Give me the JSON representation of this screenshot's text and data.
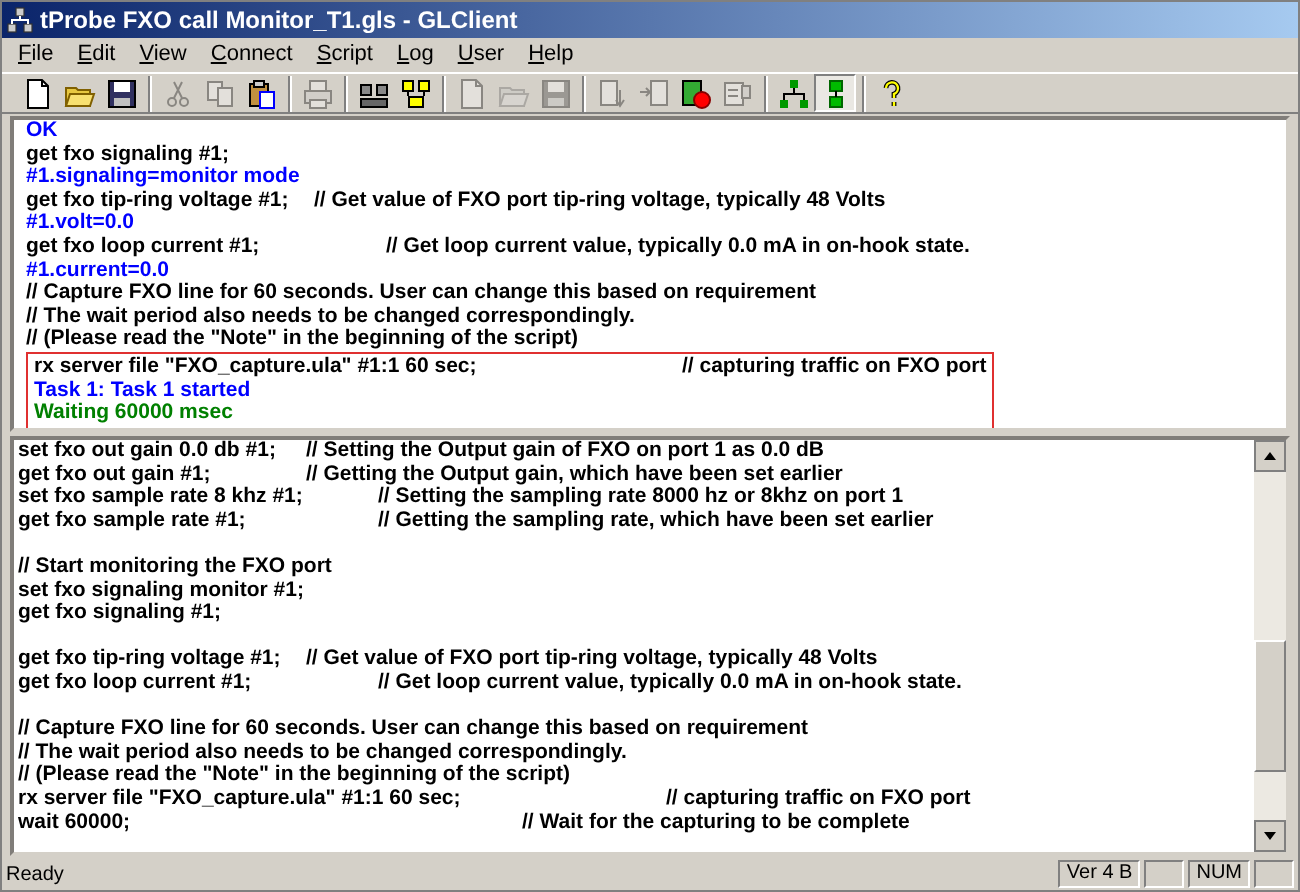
{
  "window": {
    "title": "tProbe FXO call Monitor_T1.gls - GLClient"
  },
  "menu": [
    "File",
    "Edit",
    "View",
    "Connect",
    "Script",
    "Log",
    "User",
    "Help"
  ],
  "toolbar": [
    [
      {
        "kind": "new",
        "disabled": false,
        "pressed": false
      },
      {
        "kind": "open",
        "disabled": false,
        "pressed": false
      },
      {
        "kind": "save",
        "disabled": false,
        "pressed": false
      }
    ],
    [
      {
        "kind": "cut",
        "disabled": true,
        "pressed": false
      },
      {
        "kind": "copy",
        "disabled": true,
        "pressed": false
      },
      {
        "kind": "paste",
        "disabled": false,
        "pressed": false
      }
    ],
    [
      {
        "kind": "print",
        "disabled": true,
        "pressed": false
      }
    ],
    [
      {
        "kind": "connect",
        "disabled": false,
        "pressed": false
      },
      {
        "kind": "disconnect",
        "disabled": false,
        "pressed": false
      }
    ],
    [
      {
        "kind": "new",
        "disabled": true,
        "pressed": false
      },
      {
        "kind": "open",
        "disabled": true,
        "pressed": false
      },
      {
        "kind": "save",
        "disabled": true,
        "pressed": false
      }
    ],
    [
      {
        "kind": "import",
        "disabled": true,
        "pressed": false
      },
      {
        "kind": "export",
        "disabled": true,
        "pressed": false
      },
      {
        "kind": "record",
        "disabled": false,
        "pressed": false
      },
      {
        "kind": "properties",
        "disabled": true,
        "pressed": false
      }
    ],
    [
      {
        "kind": "tree",
        "disabled": false,
        "pressed": false
      },
      {
        "kind": "stack",
        "disabled": false,
        "pressed": true
      }
    ],
    [
      {
        "kind": "help",
        "disabled": false,
        "pressed": false
      }
    ]
  ],
  "output_pane": {
    "lines": [
      {
        "text": "OK",
        "color": "#0000ff"
      },
      {
        "text": "get fxo signaling #1;",
        "color": "#000000"
      },
      {
        "text": "#1.signaling=monitor mode",
        "color": "#0000ff"
      },
      {
        "text": "get fxo tip-ring voltage #1;\t// Get value of FXO port tip-ring voltage, typically 48 Volts",
        "color": "#000000"
      },
      {
        "text": "#1.volt=0.0",
        "color": "#0000ff"
      },
      {
        "text": "get fxo loop current #1;\t\t// Get loop current value, typically 0.0 mA in on-hook state.",
        "color": "#000000"
      },
      {
        "text": "#1.current=0.0",
        "color": "#0000ff"
      },
      {
        "text": "// Capture FXO line for 60 seconds. User can change this based on requirement",
        "color": "#000000"
      },
      {
        "text": "// The wait period also needs to be changed correspondingly.",
        "color": "#000000"
      },
      {
        "text": "// (Please read the \"Note\" in the beginning of the script)",
        "color": "#000000"
      }
    ],
    "highlighted_lines": [
      {
        "text": "rx server file \"FXO_capture.ula\" #1:1 60 sec;\t\t\t// capturing traffic on FXO port",
        "color": "#000000"
      },
      {
        "text": "Task 1: Task 1 started",
        "color": "#0000ff"
      },
      {
        "text": "Waiting 60000 msec",
        "color": "#008000"
      }
    ]
  },
  "script_pane": {
    "blocks": [
      [
        "set fxo out gain 0.0 db #1;\t// Setting the Output gain of FXO on port 1 as 0.0 dB",
        "get fxo out gain #1;\t\t// Getting the Output gain, which have been set earlier",
        "set fxo sample rate 8 khz #1;\t\t// Setting the sampling rate 8000 hz or 8khz on port 1",
        "get fxo sample rate #1;\t\t// Getting the sampling rate, which have been set earlier"
      ],
      [
        "// Start monitoring the FXO port",
        "set fxo signaling monitor #1;",
        "get fxo signaling #1;"
      ],
      [
        "get fxo tip-ring voltage #1;\t// Get value of FXO port tip-ring voltage, typically 48 Volts",
        "get fxo loop current #1;\t\t// Get loop current value, typically 0.0 mA in on-hook state."
      ],
      [
        "// Capture FXO line for 60 seconds. User can change this based on requirement",
        "// The wait period also needs to be changed correspondingly.",
        "// (Please read the \"Note\" in the beginning of the script)",
        "rx server file \"FXO_capture.ula\" #1:1 60 sec;\t\t\t// capturing traffic on FXO port",
        "wait 60000;\t\t\t\t\t\t// Wait for the capturing to be complete"
      ]
    ]
  },
  "status_bar": {
    "message": "Ready",
    "version": "Ver 4 B",
    "keyboard": "NUM"
  }
}
